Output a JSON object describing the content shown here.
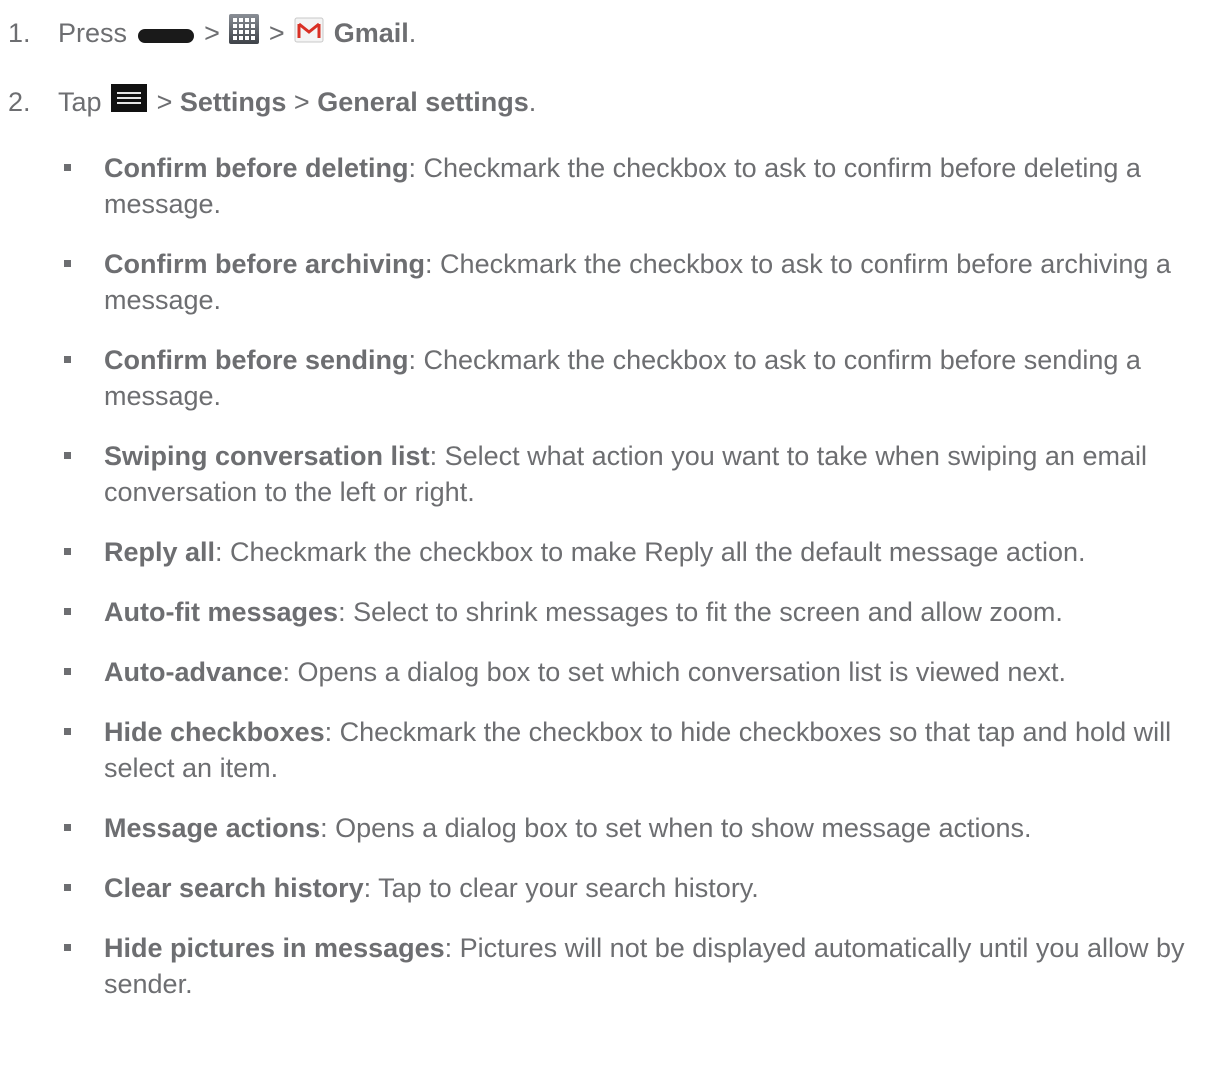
{
  "steps": [
    {
      "number": "1.",
      "press": "Press",
      "sep1": ">",
      "sep2": ">",
      "app": "Gmail",
      "end": ".",
      "icons": [
        "home-key-icon",
        "apps-grid-icon",
        "gmail-icon"
      ]
    },
    {
      "number": "2.",
      "tap": "Tap",
      "sep1": ">",
      "settings": "Settings",
      "sep2": ">",
      "general": "General settings",
      "end": ".",
      "icons": [
        "menu-icon"
      ]
    }
  ],
  "items": [
    {
      "term": "Confirm before deleting",
      "desc": ": Checkmark the checkbox to ask to confirm before deleting a message."
    },
    {
      "term": "Confirm before archiving",
      "desc": ": Checkmark the checkbox to ask to confirm before archiving a message."
    },
    {
      "term": "Confirm before sending",
      "desc": ": Checkmark the checkbox to ask to confirm before sending a message."
    },
    {
      "term": "Swiping conversation list",
      "desc": ": Select what action you want to take when swiping an email conversation to the left or right."
    },
    {
      "term": "Reply all",
      "desc": ": Checkmark the checkbox to make Reply all the default message action."
    },
    {
      "term": "Auto-fit messages",
      "desc": ": Select to shrink messages to fit the screen and allow zoom."
    },
    {
      "term": "Auto-advance",
      "desc": ": Opens a dialog box to set which conversation list is viewed next."
    },
    {
      "term": "Hide checkboxes",
      "desc": ": Checkmark the checkbox to hide checkboxes so that tap and hold will select an item."
    },
    {
      "term": "Message actions",
      "desc": ": Opens a dialog box to set when to show message actions."
    },
    {
      "term": "Clear search history",
      "desc": ": Tap to clear your search history."
    },
    {
      "term": "Hide pictures in messages",
      "desc": ": Pictures will not be displayed automatically until you allow by sender."
    }
  ],
  "colors": {
    "text": "#6d6e71",
    "gmail_red": "#d93025",
    "icon_dark": "#1a1a1a"
  }
}
